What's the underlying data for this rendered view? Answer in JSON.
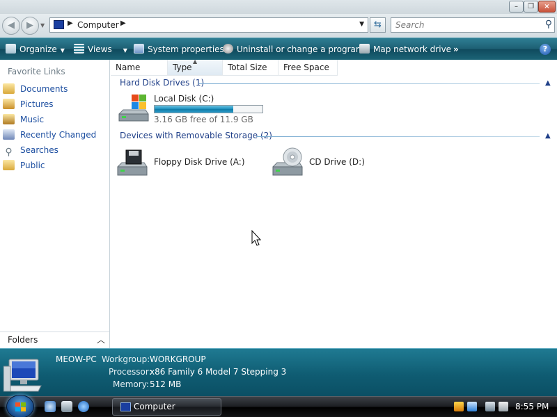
{
  "window": {
    "address": "Computer",
    "search_placeholder": "Search",
    "help_label": "?"
  },
  "commands": {
    "organize": "Organize",
    "views": "Views",
    "system_properties": "System properties",
    "uninstall": "Uninstall or change a program",
    "map_drive": "Map network drive",
    "more": "»"
  },
  "sidebar": {
    "header": "Favorite Links",
    "items": [
      {
        "label": "Documents"
      },
      {
        "label": "Pictures"
      },
      {
        "label": "Music"
      },
      {
        "label": "Recently Changed"
      },
      {
        "label": "Searches"
      },
      {
        "label": "Public"
      }
    ],
    "folders_label": "Folders"
  },
  "columns": [
    "Name",
    "Type",
    "Total Size",
    "Free Space"
  ],
  "groups": {
    "hard_disks": {
      "title": "Hard Disk Drives (1)",
      "items": [
        {
          "name": "Local Disk (C:)",
          "free_text": "3.16 GB free of 11.9 GB",
          "used_fraction": 0.73
        }
      ]
    },
    "removable": {
      "title": "Devices with Removable Storage (2)",
      "items": [
        {
          "name": "Floppy Disk Drive (A:)"
        },
        {
          "name": "CD Drive (D:)"
        }
      ]
    }
  },
  "details": {
    "computer_name": "MEOW-PC",
    "workgroup_label": "Workgroup:",
    "workgroup_value": "WORKGROUP",
    "processor_label": "Processor:",
    "processor_value": "x86 Family 6 Model 7 Stepping 3",
    "memory_label": "Memory:",
    "memory_value": "512 MB"
  },
  "taskbar": {
    "task_label": "Computer",
    "clock": "8:55 PM"
  },
  "colors": {
    "command_bar": "#1d5f73",
    "details_pane": "#0f5c72",
    "link": "#1c4ea0",
    "group_title": "#1f3f88",
    "disk_fill": "#1b8fbd"
  }
}
